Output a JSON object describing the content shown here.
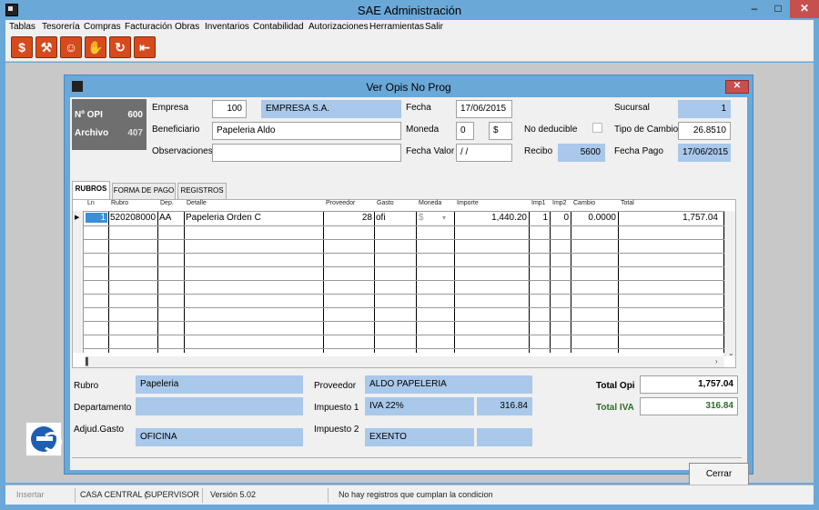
{
  "app": {
    "title": "SAE Administración",
    "min": "–",
    "max": "□",
    "close": "✕"
  },
  "menu": [
    {
      "label": "Tablas"
    },
    {
      "label": "Tesorería"
    },
    {
      "label": "Compras"
    },
    {
      "label": "Facturación"
    },
    {
      "label": "Obras"
    },
    {
      "label": "Inventarios"
    },
    {
      "label": "Contabilidad"
    },
    {
      "label": "Autorizaciones"
    },
    {
      "label": "Herramientas"
    },
    {
      "label": "Salir"
    }
  ],
  "toolbar_icons": [
    "dollar-icon",
    "wrench-icon",
    "worker-icon",
    "hand-icon",
    "refresh-icon",
    "exit-icon"
  ],
  "dialog": {
    "title": "Ver Opis No Prog",
    "close": "✕",
    "opi_label": "Nº OPI",
    "opi_value": "600",
    "archivo_label": "Archivo",
    "archivo_value": "407",
    "empresa_label": "Empresa",
    "empresa_code": "100",
    "empresa_name": "EMPRESA S.A.",
    "fecha_label": "Fecha",
    "fecha_value": "17/06/2015",
    "sucursal_label": "Sucursal",
    "sucursal_value": "1",
    "beneficiario_label": "Beneficiario",
    "beneficiario_value": "Papeleria Aldo",
    "moneda_label": "Moneda",
    "moneda_code": "0",
    "moneda_symbol": "$",
    "no_deducible_label": "No deducible",
    "tipo_cambio_label": "Tipo de Cambio",
    "tipo_cambio_value": "26.8510",
    "observaciones_label": "Observaciones",
    "observaciones_value": "",
    "fecha_valor_label": "Fecha Valor",
    "fecha_valor_value": " / /",
    "recibo_label": "Recibo",
    "recibo_value": "5600",
    "fecha_pago_label": "Fecha Pago",
    "fecha_pago_value": "17/06/2015"
  },
  "tabs": [
    {
      "label": "RUBROS"
    },
    {
      "label": "FORMA DE PAGO"
    },
    {
      "label": "REGISTROS"
    }
  ],
  "grid": {
    "columns": [
      "Ln",
      "Rubro",
      "Dep.",
      "Detalle",
      "Proveedor",
      "Gasto",
      "Moneda",
      "Importe",
      "Imp1",
      "Imp2",
      "Cambio",
      "Total"
    ],
    "row": {
      "ln": "1",
      "rubro": "520208000",
      "dep": "AA",
      "detalle": "Papeleria Orden C",
      "proveedor": "28",
      "gasto": "ofi",
      "moneda": "$",
      "importe": "1,440.20",
      "imp1": "1",
      "imp2": "0",
      "cambio": "0.0000",
      "total": "1,757.04"
    }
  },
  "details": {
    "rubro_label": "Rubro",
    "rubro_value": "Papeleria",
    "departamento_label": "Departamento",
    "departamento_value": "",
    "adjud_label": "Adjud.Gasto",
    "adjud_value": "OFICINA",
    "proveedor_label": "Proveedor",
    "proveedor_value": "ALDO PAPELERIA",
    "impuesto1_label": "Impuesto 1",
    "impuesto1_name": "IVA 22%",
    "impuesto1_amount": "316.84",
    "impuesto2_label": "Impuesto 2",
    "impuesto2_name": "EXENTO",
    "impuesto2_amount": "",
    "total_opi_label": "Total Opi",
    "total_opi_value": "1,757.04",
    "total_iva_label": "Total IVA",
    "total_iva_value": "316.84"
  },
  "buttons": {
    "cerrar": "Cerrar"
  },
  "status": {
    "mode": "Insertar",
    "branch": "CASA CENTRAL (",
    "user": "SUPERVISOR",
    "version": "Versión 5.02",
    "message": "No hay registros que cumplan la condicion"
  },
  "colors": {
    "accent": "#6aa8d8",
    "field_blue": "#a9c8ea",
    "iva_green": "#2f6d2f",
    "close_red": "#c7504f"
  }
}
